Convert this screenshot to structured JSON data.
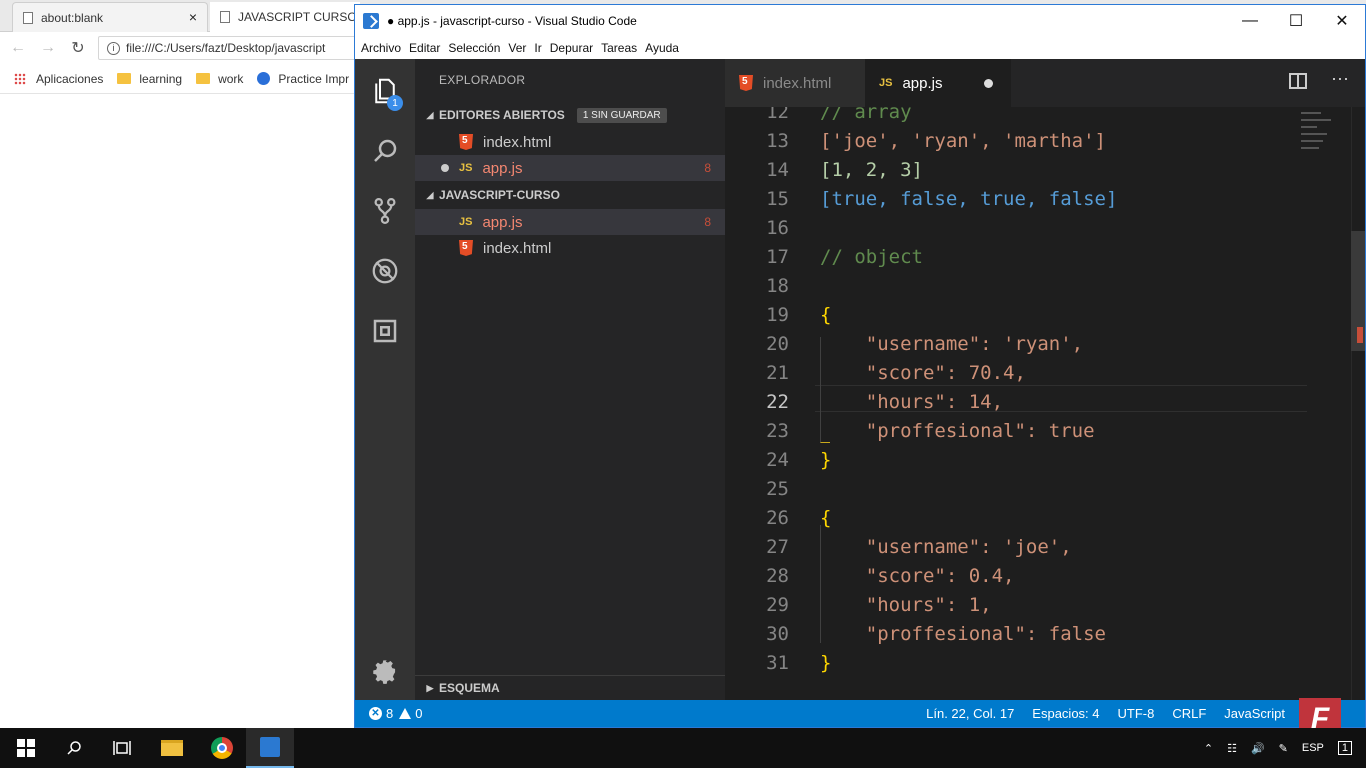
{
  "browser": {
    "tabs": [
      {
        "label": "about:blank",
        "close": "×"
      },
      {
        "label": "JAVASCRIPT CURSO"
      }
    ],
    "address": "file:///C:/Users/fazt/Desktop/javascript",
    "bookmarks": [
      "Aplicaciones",
      "learning",
      "work",
      "Practice Impr"
    ]
  },
  "vscode": {
    "title": "● app.js - javascript-curso - Visual Studio Code",
    "window_controls": {
      "minimize": "—",
      "maximize": "☐",
      "close": "✕"
    },
    "menu": [
      "Archivo",
      "Editar",
      "Selección",
      "Ver",
      "Ir",
      "Depurar",
      "Tareas",
      "Ayuda"
    ],
    "activity_badge": "1",
    "sidebar": {
      "title": "EXPLORADOR",
      "open_editors": {
        "label": "EDITORES ABIERTOS",
        "pill": "1 SIN GUARDAR"
      },
      "open_files": [
        {
          "name": "index.html",
          "type": "html"
        },
        {
          "name": "app.js",
          "type": "js",
          "errors": "8"
        }
      ],
      "project": {
        "label": "JAVASCRIPT-CURSO"
      },
      "project_files": [
        {
          "name": "app.js",
          "type": "js",
          "errors": "8"
        },
        {
          "name": "index.html",
          "type": "html"
        }
      ],
      "outline": "ESQUEMA"
    },
    "tabs": [
      {
        "label": "index.html",
        "icon": "html5-icon"
      },
      {
        "label": "app.js",
        "icon": "js-icon",
        "modified": true
      }
    ],
    "editor": {
      "current_line": 22,
      "lines": [
        {
          "n": "12",
          "text": "// array"
        },
        {
          "n": "13",
          "text": "['joe', 'ryan', 'martha']"
        },
        {
          "n": "14",
          "text": "[1, 2, 3]"
        },
        {
          "n": "15",
          "text": "[true, false, true, false]"
        },
        {
          "n": "16",
          "text": ""
        },
        {
          "n": "17",
          "text": "// object"
        },
        {
          "n": "18",
          "text": ""
        },
        {
          "n": "19",
          "text": "{"
        },
        {
          "n": "20",
          "text": "    \"username\": 'ryan',"
        },
        {
          "n": "21",
          "text": "    \"score\": 70.4,"
        },
        {
          "n": "22",
          "text": "    \"hours\": 14,"
        },
        {
          "n": "23",
          "text": "    \"proffesional\": true"
        },
        {
          "n": "24",
          "text": "}"
        },
        {
          "n": "25",
          "text": ""
        },
        {
          "n": "26",
          "text": "{"
        },
        {
          "n": "27",
          "text": "    \"username\": 'joe',"
        },
        {
          "n": "28",
          "text": "    \"score\": 0.4,"
        },
        {
          "n": "29",
          "text": "    \"hours\": 1,"
        },
        {
          "n": "30",
          "text": "    \"proffesional\": false"
        },
        {
          "n": "31",
          "text": "}"
        }
      ]
    },
    "statusbar": {
      "errors": "8",
      "warnings": "0",
      "position": "Lín. 22, Col. 17",
      "spaces": "Espacios: 4",
      "encoding": "UTF-8",
      "eol": "CRLF",
      "language": "JavaScript"
    }
  },
  "logo_letter": "F",
  "taskbar": {
    "tray_lang": "ESP",
    "notification_count": "1"
  },
  "colors": {
    "accent": "#007acc",
    "error": "#c74e39",
    "comment": "#608b4e",
    "string": "#ce9178",
    "number": "#b5cea8",
    "keyword": "#569cd6",
    "bracket": "#ffd700"
  }
}
